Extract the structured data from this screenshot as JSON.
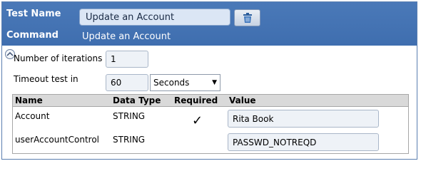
{
  "header": {
    "test_name_label": "Test Name",
    "test_name_value": "Update an Account",
    "command_label": "Command",
    "command_value": "Update an Account",
    "delete_icon": "trash-icon"
  },
  "form": {
    "iterations_label": "Number of iterations",
    "iterations_value": "1",
    "timeout_label": "Timeout test in",
    "timeout_value": "60",
    "timeout_unit": "Seconds",
    "collapse_icon": "collapse-up-icon"
  },
  "table": {
    "columns": [
      "Name",
      "Data Type",
      "Required",
      "Value"
    ],
    "rows": [
      {
        "name": "Account",
        "type": "STRING",
        "required": "✓",
        "value": "Rita Book"
      },
      {
        "name": "userAccountControl",
        "type": "STRING",
        "required": "",
        "value": "PASSWD_NOTREQD"
      }
    ]
  },
  "colors": {
    "header_bg": "#4273b3",
    "input_bg": "#dbe6f5",
    "table_header_bg": "#d9d9d9"
  }
}
